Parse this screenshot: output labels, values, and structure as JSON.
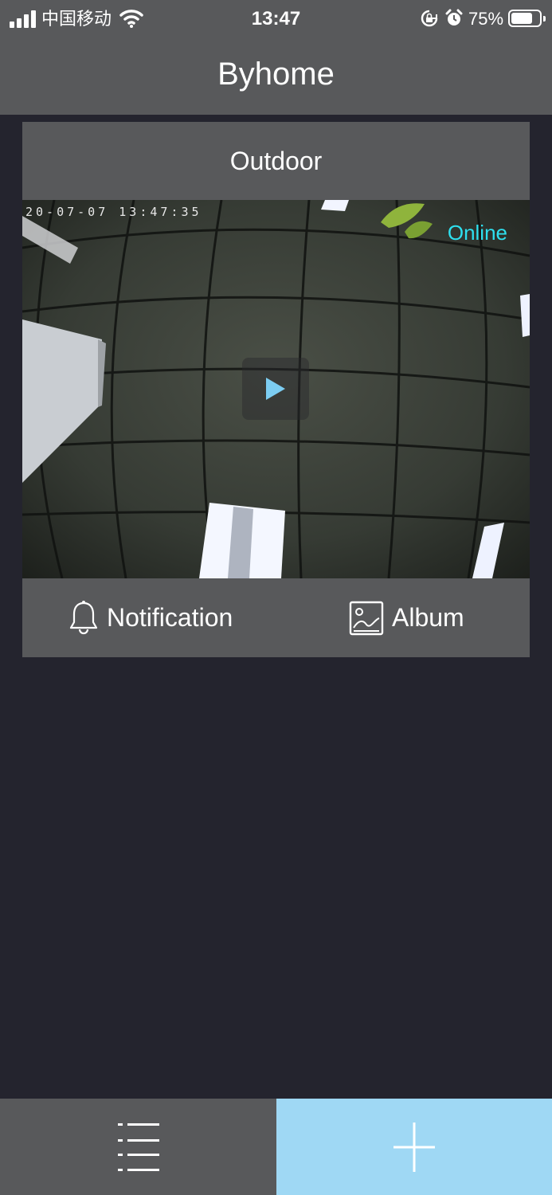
{
  "status_bar": {
    "carrier": "中国移动",
    "time": "13:47",
    "battery_percent": "75%",
    "battery_level": 0.75,
    "icons": [
      "signal-icon",
      "wifi-icon",
      "orientation-lock-icon",
      "alarm-icon",
      "battery-icon"
    ]
  },
  "header": {
    "title": "Byhome"
  },
  "camera": {
    "name": "Outdoor",
    "timestamp": "20-07-07 13:47:35",
    "status": "Online",
    "play_icon": "play-icon"
  },
  "actions": {
    "notification_label": "Notification",
    "notification_icon": "bell-icon",
    "album_label": "Album",
    "album_icon": "image-icon"
  },
  "tabbar": {
    "list_icon": "list-icon",
    "add_icon": "plus-icon"
  },
  "colors": {
    "bar_gray": "#58595b",
    "background": "#24242e",
    "online_cyan": "#2ee0ef",
    "play_blue": "#7ccdf2",
    "add_tab_blue": "#9fd8f4"
  }
}
